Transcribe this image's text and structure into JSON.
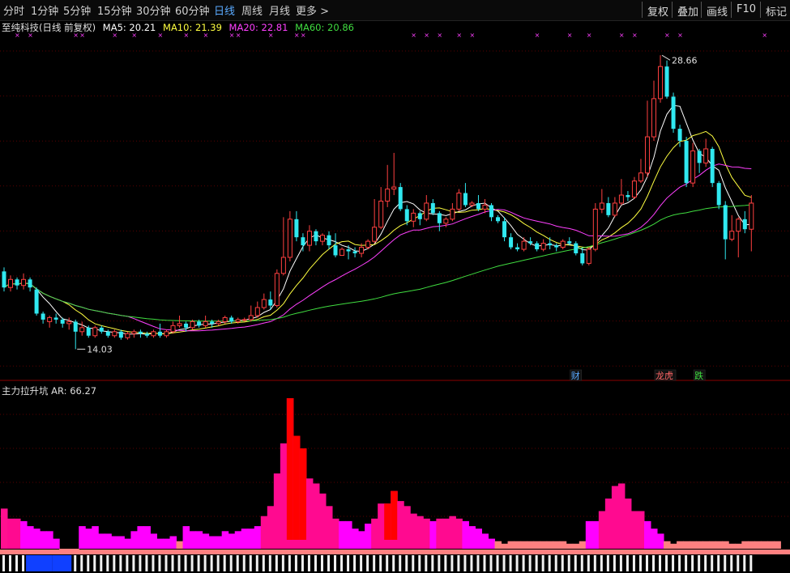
{
  "toolbar": {
    "periods": [
      "分时",
      "1分钟",
      "5分钟",
      "15分钟",
      "30分钟",
      "60分钟",
      "日线",
      "周线",
      "月线",
      "更多 >"
    ],
    "active_period": "日线",
    "right_buttons": [
      "复权",
      "叠加",
      "画线",
      "F10",
      "标记"
    ]
  },
  "legend": {
    "stock_title": "至纯科技(日线 前复权)",
    "ma5": "MA5: 20.21",
    "ma10": "MA10: 21.39",
    "ma20": "MA20: 22.81",
    "ma60": "MA60: 20.86",
    "colors": {
      "ma5": "#ffffff",
      "ma10": "#ffff40",
      "ma20": "#ff40ff",
      "ma60": "#40dd40"
    }
  },
  "price_annotations": {
    "high": "28.66",
    "low": "14.03"
  },
  "event_markers": [
    "财",
    "龙虎",
    "跌"
  ],
  "indicator": {
    "name": "主力拉升坑",
    "value": "AR: 66.27"
  },
  "chart_data": {
    "type": "candlestick",
    "price_range": [
      13.2,
      29.8
    ],
    "high_label": 28.66,
    "low_label": 14.03,
    "candles": [
      [
        17.9,
        17.1,
        18.1,
        16.9
      ],
      [
        17.1,
        17.5,
        17.7,
        16.9
      ],
      [
        17.5,
        17.2,
        17.6,
        17.0
      ],
      [
        17.2,
        17.5,
        17.8,
        17.0
      ],
      [
        17.5,
        17.1,
        17.6,
        16.9
      ],
      [
        17.0,
        15.8,
        17.1,
        15.7
      ],
      [
        15.8,
        15.5,
        15.9,
        15.3
      ],
      [
        15.4,
        15.6,
        15.7,
        15.1
      ],
      [
        15.6,
        15.5,
        15.8,
        15.3
      ],
      [
        15.5,
        15.3,
        15.6,
        15.1
      ],
      [
        15.3,
        15.4,
        15.6,
        15.0
      ],
      [
        15.4,
        14.9,
        15.5,
        14.03
      ],
      [
        14.9,
        15.1,
        15.4,
        14.7
      ],
      [
        15.1,
        14.7,
        15.2,
        14.6
      ],
      [
        14.7,
        15.1,
        15.2,
        14.6
      ],
      [
        15.1,
        14.9,
        15.2,
        14.8
      ],
      [
        14.9,
        14.7,
        15.0,
        14.6
      ],
      [
        14.7,
        14.9,
        15.0,
        14.6
      ],
      [
        14.9,
        14.6,
        15.0,
        14.5
      ],
      [
        14.6,
        14.8,
        14.9,
        14.5
      ],
      [
        14.8,
        14.9,
        15.0,
        14.6
      ],
      [
        14.9,
        14.8,
        15.0,
        14.6
      ],
      [
        14.8,
        14.7,
        14.9,
        14.6
      ],
      [
        14.7,
        14.9,
        15.0,
        14.6
      ],
      [
        14.9,
        14.7,
        15.3,
        14.6
      ],
      [
        14.7,
        14.9,
        15.0,
        14.6
      ],
      [
        14.9,
        15.2,
        15.4,
        14.8
      ],
      [
        15.2,
        15.3,
        15.7,
        15.1
      ],
      [
        15.3,
        15.1,
        15.4,
        14.9
      ],
      [
        15.1,
        15.4,
        15.5,
        15.0
      ],
      [
        15.4,
        15.2,
        15.5,
        15.1
      ],
      [
        15.2,
        15.4,
        15.7,
        15.1
      ],
      [
        15.4,
        15.3,
        15.5,
        15.1
      ],
      [
        15.3,
        15.4,
        15.5,
        15.2
      ],
      [
        15.4,
        15.6,
        15.7,
        15.3
      ],
      [
        15.6,
        15.4,
        15.7,
        15.3
      ],
      [
        15.4,
        15.5,
        15.6,
        15.3
      ],
      [
        15.5,
        15.5,
        15.6,
        15.4
      ],
      [
        15.5,
        15.7,
        16.2,
        15.4
      ],
      [
        15.7,
        16.1,
        16.4,
        15.6
      ],
      [
        16.1,
        16.5,
        16.8,
        16.0
      ],
      [
        16.5,
        16.2,
        16.9,
        16.0
      ],
      [
        16.2,
        17.8,
        18.0,
        16.1
      ],
      [
        17.8,
        18.6,
        20.6,
        17.7
      ],
      [
        18.6,
        20.5,
        20.9,
        18.4
      ],
      [
        20.5,
        19.6,
        20.9,
        19.4
      ],
      [
        19.6,
        19.2,
        19.8,
        18.9
      ],
      [
        19.2,
        19.9,
        20.2,
        18.9
      ],
      [
        19.9,
        19.4,
        20.0,
        19.2
      ],
      [
        19.4,
        19.7,
        19.8,
        19.2
      ],
      [
        19.7,
        19.2,
        19.9,
        19.0
      ],
      [
        19.2,
        18.7,
        19.8,
        18.6
      ],
      [
        18.7,
        19.0,
        19.1,
        18.7
      ],
      [
        19.0,
        18.9,
        19.2,
        18.5
      ],
      [
        18.9,
        18.8,
        19.1,
        18.6
      ],
      [
        18.8,
        19.1,
        19.3,
        18.6
      ],
      [
        19.1,
        19.4,
        19.5,
        19.0
      ],
      [
        19.4,
        20.1,
        21.5,
        19.3
      ],
      [
        20.1,
        21.4,
        22.1,
        20.0
      ],
      [
        21.4,
        22.0,
        23.2,
        21.1
      ],
      [
        22.0,
        22.1,
        23.8,
        21.7
      ],
      [
        22.1,
        21.0,
        22.3,
        20.9
      ],
      [
        21.0,
        20.4,
        21.2,
        20.2
      ],
      [
        20.4,
        20.8,
        21.0,
        20.1
      ],
      [
        20.8,
        20.5,
        20.9,
        20.2
      ],
      [
        20.5,
        21.3,
        21.7,
        20.4
      ],
      [
        21.3,
        20.8,
        21.5,
        20.7
      ],
      [
        20.8,
        20.3,
        20.9,
        19.9
      ],
      [
        20.3,
        20.5,
        20.6,
        20.1
      ],
      [
        20.5,
        21.0,
        21.3,
        20.4
      ],
      [
        21.0,
        21.8,
        22.0,
        20.9
      ],
      [
        21.8,
        21.2,
        22.3,
        21.1
      ],
      [
        21.2,
        21.3,
        21.4,
        21.1
      ],
      [
        21.3,
        21.0,
        21.7,
        20.9
      ],
      [
        21.0,
        21.2,
        21.5,
        20.8
      ],
      [
        21.2,
        20.6,
        21.3,
        20.4
      ],
      [
        20.6,
        20.4,
        20.7,
        20.3
      ],
      [
        20.4,
        19.6,
        20.6,
        19.4
      ],
      [
        19.6,
        19.1,
        19.8,
        19.0
      ],
      [
        19.1,
        19.0,
        19.3,
        18.9
      ],
      [
        19.0,
        19.4,
        19.6,
        18.9
      ],
      [
        19.4,
        19.3,
        19.6,
        19.2
      ],
      [
        19.3,
        19.0,
        19.4,
        18.9
      ],
      [
        19.0,
        19.3,
        19.5,
        18.9
      ],
      [
        19.3,
        19.2,
        19.6,
        19.0
      ],
      [
        19.2,
        19.1,
        19.3,
        18.9
      ],
      [
        19.1,
        19.4,
        19.5,
        19.0
      ],
      [
        19.4,
        19.3,
        19.6,
        19.2
      ],
      [
        19.3,
        18.8,
        19.4,
        18.7
      ],
      [
        18.8,
        18.3,
        19.1,
        18.2
      ],
      [
        18.3,
        19.0,
        19.1,
        18.2
      ],
      [
        19.0,
        21.0,
        21.3,
        18.9
      ],
      [
        21.0,
        21.3,
        22.0,
        20.8
      ],
      [
        21.3,
        20.7,
        21.6,
        20.6
      ],
      [
        20.7,
        21.3,
        21.6,
        20.6
      ],
      [
        21.3,
        21.7,
        22.5,
        21.2
      ],
      [
        21.7,
        21.6,
        21.9,
        21.4
      ],
      [
        21.6,
        22.4,
        22.6,
        21.5
      ],
      [
        22.4,
        22.8,
        23.5,
        22.3
      ],
      [
        22.8,
        24.6,
        26.4,
        22.6
      ],
      [
        24.6,
        26.5,
        27.4,
        24.4
      ],
      [
        26.5,
        28.1,
        28.66,
        26.3
      ],
      [
        28.1,
        26.6,
        28.4,
        26.5
      ],
      [
        26.6,
        25.0,
        26.8,
        24.8
      ],
      [
        25.0,
        24.4,
        25.2,
        24.1
      ],
      [
        24.4,
        22.3,
        24.6,
        22.1
      ],
      [
        22.3,
        23.9,
        24.3,
        22.1
      ],
      [
        23.9,
        23.3,
        24.0,
        22.8
      ],
      [
        23.3,
        24.0,
        24.5,
        23.1
      ],
      [
        24.0,
        22.3,
        24.1,
        22.1
      ],
      [
        22.3,
        21.2,
        22.4,
        21.0
      ],
      [
        21.2,
        19.5,
        21.4,
        18.5
      ],
      [
        19.5,
        19.9,
        20.7,
        19.4
      ],
      [
        19.9,
        20.5,
        20.6,
        18.6
      ],
      [
        20.5,
        20.0,
        20.9,
        19.8
      ],
      [
        20.0,
        21.3,
        21.7,
        18.9
      ]
    ],
    "ma_series": [
      "MA5",
      "MA10",
      "MA20",
      "MA60"
    ],
    "indicator_bars": [
      16,
      12,
      12,
      11,
      9,
      8,
      7,
      7,
      4,
      0,
      0,
      0,
      9,
      8,
      9,
      6,
      6,
      5,
      5,
      4,
      7,
      9,
      9,
      6,
      4,
      4,
      5,
      3,
      9,
      7,
      7,
      6,
      5,
      5,
      7,
      6,
      7,
      8,
      8,
      9,
      13,
      17,
      30,
      42,
      60,
      45,
      40,
      28,
      26,
      22,
      17,
      12,
      11,
      11,
      8,
      7,
      10,
      12,
      18,
      18,
      23,
      19,
      17,
      14,
      13,
      12,
      11,
      12,
      12,
      13,
      12,
      11,
      9,
      8,
      6,
      4,
      3,
      2,
      3,
      3,
      3,
      3,
      3,
      3,
      3,
      3,
      3,
      2,
      2,
      3,
      11,
      11,
      15,
      20,
      25,
      26,
      20,
      15,
      15,
      11,
      8,
      6,
      3,
      2,
      3,
      3,
      3,
      3,
      3,
      3,
      3,
      3,
      2,
      2,
      3,
      3,
      3,
      3,
      3,
      3
    ],
    "indicator_highlights": [
      [
        44,
        46
      ],
      [
        59,
        60
      ],
      [
        100,
        101
      ]
    ],
    "indicator_range": [
      0,
      60
    ],
    "bottom_strip_blue": [
      [
        4,
        7
      ],
      [
        8,
        10
      ]
    ]
  }
}
